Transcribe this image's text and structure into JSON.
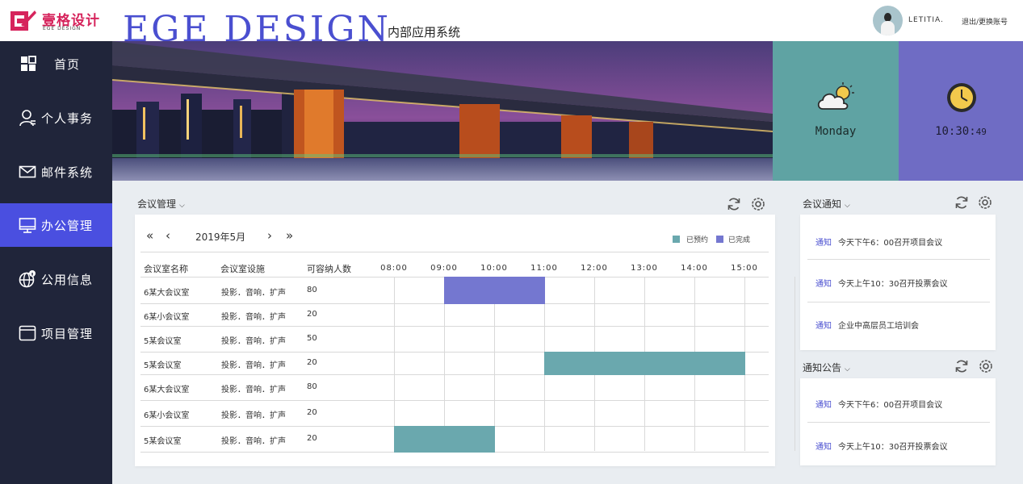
{
  "header": {
    "logo_cn": "壹格设计",
    "logo_en": "EGE DESIGN",
    "brand_big": "EGE DESIGN",
    "system_name": "内部应用系统",
    "username": "LETITIA.",
    "logout_label": "退出/更换账号"
  },
  "sidebar": {
    "active_color": "#4a4fe0",
    "items": [
      {
        "label": "首页",
        "icon": "grid-icon"
      },
      {
        "label": "个人事务",
        "icon": "user-icon"
      },
      {
        "label": "邮件系统",
        "icon": "mail-icon"
      },
      {
        "label": "办公管理",
        "icon": "monitor-icon",
        "active": true
      },
      {
        "label": "公用信息",
        "icon": "globe-info-icon"
      },
      {
        "label": "项目管理",
        "icon": "window-icon"
      }
    ]
  },
  "widgets": {
    "weather_day": "Monday",
    "clock_main": "10:30:",
    "clock_seconds": "49",
    "weather_color": "#5fa3a3",
    "clock_color": "#6f6cc4"
  },
  "meeting": {
    "panel_title": "会议管理",
    "month": "2019年5月",
    "legend": [
      {
        "label": "已预约",
        "color": "#6aa8ae"
      },
      {
        "label": "已完成",
        "color": "#7477d0"
      }
    ],
    "columns": [
      "会议室名称",
      "会议室设施",
      "可容纳人数"
    ],
    "times": [
      "08:00",
      "09:00",
      "10:00",
      "11:00",
      "12:00",
      "13:00",
      "14:00",
      "15:00"
    ],
    "rows": [
      {
        "name": "6某大会议室",
        "facility": "投影．音响．扩声",
        "capacity": "80"
      },
      {
        "name": "6某小会议室",
        "facility": "投影．音响．扩声",
        "capacity": "20"
      },
      {
        "name": "5某会议室",
        "facility": "投影．音响．扩声",
        "capacity": "50"
      },
      {
        "name": "5某会议室",
        "facility": "投影．音响．扩声",
        "capacity": "20"
      },
      {
        "name": "6某大会议室",
        "facility": "投影．音响．扩声",
        "capacity": "80"
      },
      {
        "name": "6某小会议室",
        "facility": "投影．音响．扩声",
        "capacity": "20"
      },
      {
        "name": "5某会议室",
        "facility": "投影．音响．扩声",
        "capacity": "20"
      }
    ],
    "bookings": [
      {
        "row": 0,
        "start": "09:00",
        "end": "11:00",
        "status": "已完成"
      },
      {
        "row": 3,
        "start": "11:00",
        "end": "15:00",
        "status": "已预约"
      },
      {
        "row": 6,
        "start": "08:00",
        "end": "10:00",
        "status": "已预约"
      }
    ]
  },
  "meeting_notice": {
    "panel_title": "会议通知",
    "items": [
      {
        "tag": "通知",
        "text": "今天下午6：00召开项目会议"
      },
      {
        "tag": "通知",
        "text": "今天上午10：30召开投票会议"
      },
      {
        "tag": "通知",
        "text": "企业中高层员工培训会"
      }
    ]
  },
  "announcement": {
    "panel_title": "通知公告",
    "items": [
      {
        "tag": "通知",
        "text": "今天下午6：00召开项目会议"
      },
      {
        "tag": "通知",
        "text": "今天上午10：30召开投票会议"
      }
    ]
  }
}
